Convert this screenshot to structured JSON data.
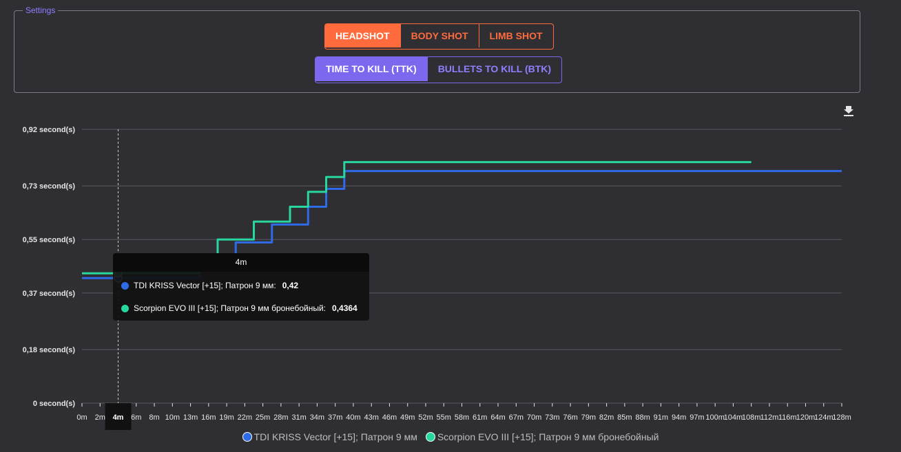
{
  "settings": {
    "legend": "Settings",
    "shot_buttons": [
      {
        "label": "HEADSHOT",
        "active": true
      },
      {
        "label": "BODY SHOT",
        "active": false
      },
      {
        "label": "LIMB SHOT",
        "active": false
      }
    ],
    "mode_buttons": [
      {
        "label": "TIME TO KILL (TTK)",
        "active": true
      },
      {
        "label": "BULLETS TO KILL (BTK)",
        "active": false
      }
    ]
  },
  "icons": {
    "download": "download-icon"
  },
  "colors": {
    "accent_orange": "#ff6b3d",
    "accent_purple": "#7b68ee",
    "series1": "#2f6be6",
    "series2": "#28d6a0"
  },
  "tooltip": {
    "title": "4m",
    "rows": [
      {
        "label": "TDI KRISS Vector [+15]; Патрон 9 мм:",
        "value": "0,42",
        "color": "#2f6be6"
      },
      {
        "label": "Scorpion EVO III [+15]; Патрон 9 мм бронебойный:",
        "value": "0,4364",
        "color": "#28d6a0"
      }
    ]
  },
  "chart_data": {
    "type": "line",
    "step": true,
    "x": [
      0,
      2,
      4,
      6,
      8,
      10,
      13,
      16,
      19,
      22,
      25,
      28,
      31,
      34,
      37,
      40,
      43,
      46,
      49,
      52,
      55,
      58,
      61,
      64,
      67,
      70,
      73,
      76,
      79,
      82,
      85,
      88,
      91,
      94,
      97,
      100,
      104,
      108,
      112,
      116,
      120,
      124,
      128
    ],
    "tick_labels": [
      "0m",
      "2m",
      "4m",
      "6m",
      "8m",
      "10m",
      "13m",
      "16m",
      "19m",
      "22m",
      "25m",
      "28m",
      "31m",
      "34m",
      "37m",
      "40m",
      "43m",
      "46m",
      "49m",
      "52m",
      "55m",
      "58m",
      "61m",
      "64m",
      "67m",
      "70m",
      "73m",
      "76m",
      "79m",
      "82m",
      "85m",
      "88m",
      "91m",
      "94m",
      "97m",
      "100m",
      "104m",
      "108m",
      "112m",
      "116m",
      "120m",
      "124m",
      "128m"
    ],
    "y_ticks": [
      0,
      0.18,
      0.37,
      0.55,
      0.73,
      0.92
    ],
    "y_tick_labels": [
      "0 second(s)",
      "0,18 second(s)",
      "0,37 second(s)",
      "0,55 second(s)",
      "0,73 second(s)",
      "0,92 second(s)"
    ],
    "ylim": [
      0,
      0.92
    ],
    "grid": true,
    "highlight_x": 4,
    "series": [
      {
        "name": "TDI KRISS Vector [+15]; Патрон 9 мм",
        "color": "#2f6be6",
        "values": [
          0.42,
          0.42,
          0.42,
          0.42,
          0.42,
          0.42,
          0.42,
          0.49,
          0.49,
          0.54,
          0.54,
          0.6,
          0.6,
          0.66,
          0.72,
          0.78,
          0.78,
          0.78,
          0.78,
          0.78,
          0.78,
          0.78,
          0.78,
          0.78,
          0.78,
          0.78,
          0.78,
          0.78,
          0.78,
          0.78,
          0.78,
          0.78,
          0.78,
          0.78,
          0.78,
          0.78,
          0.78,
          0.78,
          0.78,
          0.78,
          0.78,
          0.78,
          0.78
        ]
      },
      {
        "name": "Scorpion EVO III [+15]; Патрон 9 мм бронебойный",
        "color": "#28d6a0",
        "values": [
          0.4364,
          0.4364,
          0.4364,
          0.4364,
          0.4364,
          0.4364,
          0.4364,
          0.5,
          0.55,
          0.55,
          0.61,
          0.61,
          0.66,
          0.71,
          0.76,
          0.81,
          0.81,
          0.81,
          0.81,
          0.81,
          0.81,
          0.81,
          0.81,
          0.81,
          0.81,
          0.81,
          0.81,
          0.81,
          0.81,
          0.81,
          0.81,
          0.81,
          0.81,
          0.81,
          0.81,
          0.81,
          0.81,
          0.81
        ]
      }
    ]
  }
}
